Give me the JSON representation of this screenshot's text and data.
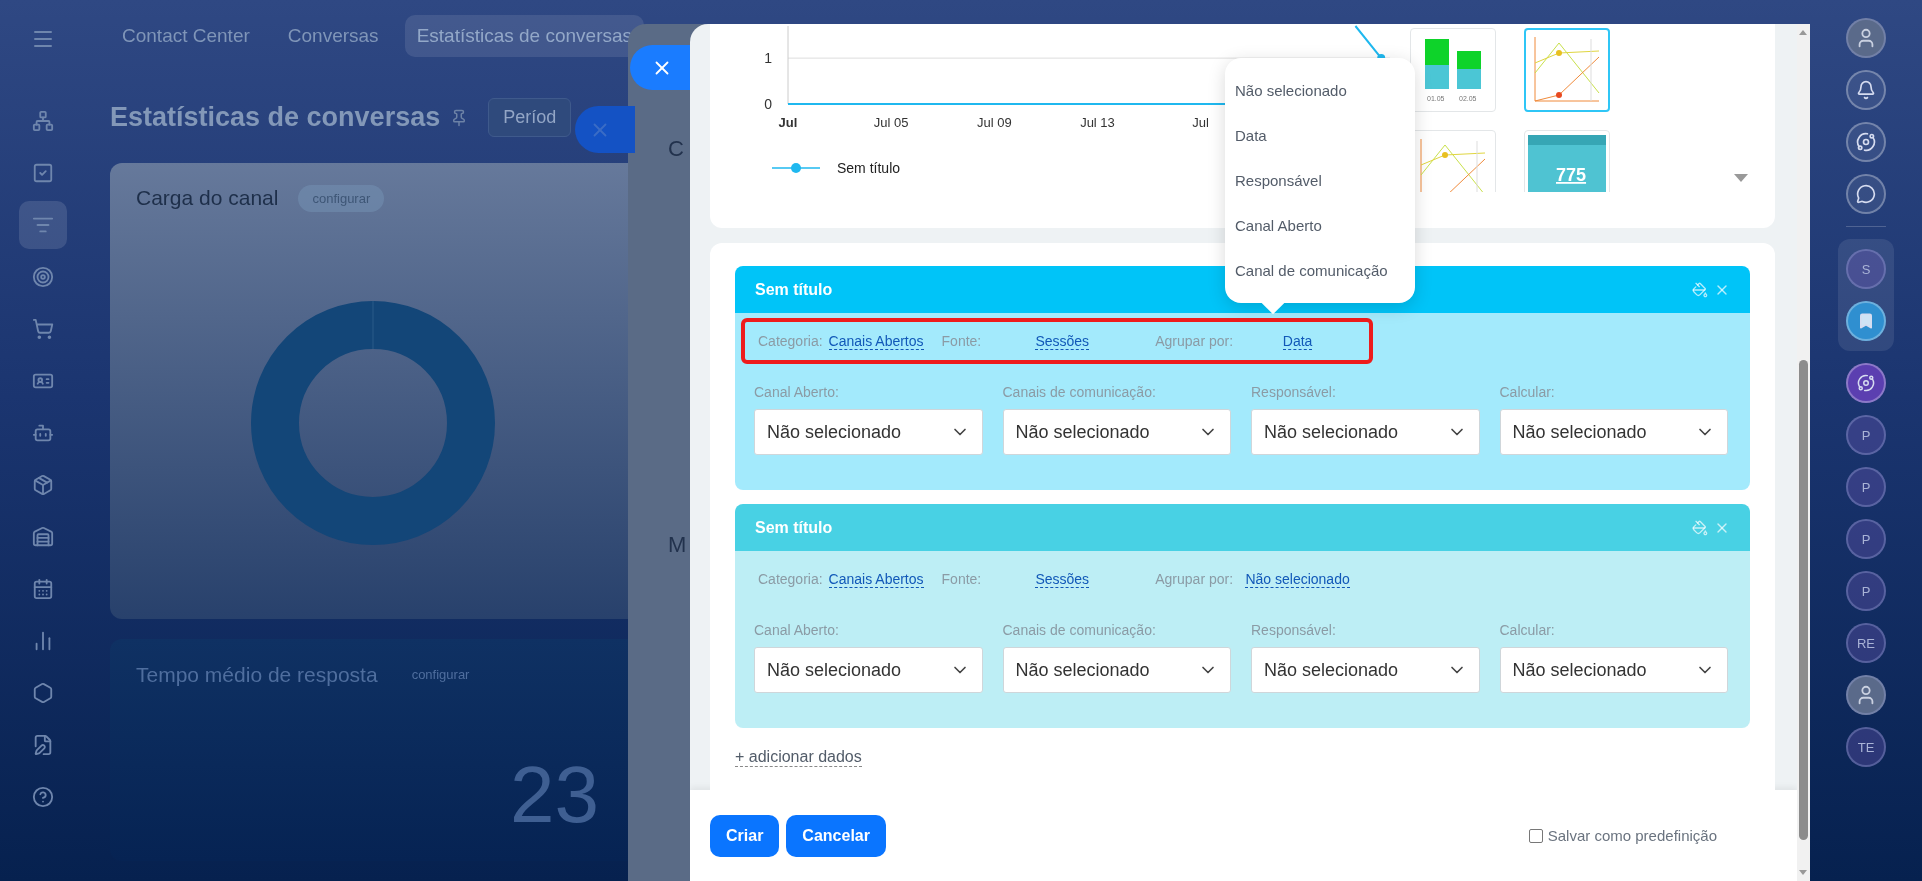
{
  "top_nav": [
    {
      "label": "Contact Center",
      "selected": false
    },
    {
      "label": "Conversas",
      "selected": false
    },
    {
      "label": "Estatísticas de conversas",
      "selected": true
    }
  ],
  "left_nav": [
    {
      "selected": false
    },
    {
      "selected": false
    },
    {
      "selected": true
    },
    {
      "selected": false
    },
    {
      "selected": false
    },
    {
      "selected": false
    },
    {
      "selected": false
    },
    {
      "selected": false
    },
    {
      "selected": false
    },
    {
      "selected": false
    },
    {
      "selected": false
    },
    {
      "selected": false
    },
    {
      "selected": false
    },
    {
      "selected": false
    }
  ],
  "page": {
    "title": "Estatísticas de conversas",
    "period_button": "Períod",
    "widgets": [
      {
        "kind": "donut",
        "title": "Carga do canal",
        "action": "configurar"
      },
      {
        "kind": "number",
        "title": "Tempo médio de resposta",
        "action": "configurar",
        "value": "23"
      }
    ]
  },
  "back_panel": {
    "texts": [
      "C",
      "M"
    ]
  },
  "editor": {
    "chart": {
      "chart_data": {
        "type": "line",
        "categories": [
          "Jul",
          null,
          null,
          null,
          "Jul 05",
          null,
          null,
          null,
          "Jul 09",
          null,
          null,
          null,
          "Jul 13",
          null,
          null,
          null,
          "Jul",
          null,
          null,
          null,
          null,
          null,
          null,
          null
        ],
        "series": [
          {
            "name": "Sem título",
            "color": "#1fb8ef",
            "values": [
              0,
              0,
              0,
              0,
              0,
              0,
              0,
              0,
              0,
              0,
              0,
              0,
              0,
              0,
              0,
              0,
              0,
              0,
              null,
              null,
              null,
              null,
              1.7,
              1
            ]
          }
        ],
        "ylim": [
          0,
          1.7
        ],
        "yticks": [
          0,
          1
        ]
      }
    },
    "chart_types": [
      {
        "kind": "bar",
        "labels": [
          "01.05",
          "02.05"
        ],
        "selected": false
      },
      {
        "kind": "line",
        "selected": true
      },
      {
        "kind": "line",
        "selected": false
      },
      {
        "kind": "number",
        "value": "775",
        "selected": false
      }
    ],
    "group_menu": [
      "Não selecionado",
      "Data",
      "Responsável",
      "Canal Aberto",
      "Canal de comunicação"
    ],
    "datasets": [
      {
        "title": "Sem título",
        "color": "#00c4f8",
        "highlighted": true,
        "fields": [
          {
            "label": "Categoria:",
            "value": "Canais Abertos"
          },
          {
            "label": "Fonte:",
            "value": "Sessões"
          },
          {
            "label": "Agrupar por:",
            "value": "Data"
          }
        ],
        "filters": [
          {
            "label": "Canal Aberto:",
            "value": "Não selecionado"
          },
          {
            "label": "Canais de comunicação:",
            "value": "Não selecionado"
          },
          {
            "label": "Responsável:",
            "value": "Não selecionado"
          },
          {
            "label": "Calcular:",
            "value": "Não selecionado"
          }
        ]
      },
      {
        "title": "Sem título",
        "color": "#48d1e4",
        "highlighted": false,
        "fields": [
          {
            "label": "Categoria:",
            "value": "Canais Abertos"
          },
          {
            "label": "Fonte:",
            "value": "Sessões"
          },
          {
            "label": "Agrupar por:",
            "value": "Não selecionado"
          }
        ],
        "filters": [
          {
            "label": "Canal Aberto:",
            "value": "Não selecionado"
          },
          {
            "label": "Canais de comunicação:",
            "value": "Não selecionado"
          },
          {
            "label": "Responsável:",
            "value": "Não selecionado"
          },
          {
            "label": "Calcular:",
            "value": "Não selecionado"
          }
        ]
      }
    ],
    "add_link": "+ adicionar dados",
    "buttons": [
      {
        "kind": "primary",
        "label": "Criar"
      },
      {
        "kind": "primary",
        "label": "Cancelar"
      }
    ],
    "save_preset": {
      "label": "Salvar como predefinição",
      "checked": false
    }
  },
  "right_rail": [
    {
      "kind": "photo"
    },
    {
      "kind": "bell"
    },
    {
      "kind": "swirl"
    },
    {
      "kind": "chat"
    },
    {
      "kind": "initials",
      "label": "S",
      "pinned": true
    },
    {
      "kind": "bookmark",
      "pinned": true
    },
    {
      "kind": "logo"
    },
    {
      "kind": "initials",
      "label": "P"
    },
    {
      "kind": "initials",
      "label": "P"
    },
    {
      "kind": "initials",
      "label": "P"
    },
    {
      "kind": "initials",
      "label": "P"
    },
    {
      "kind": "initials",
      "label": "RE"
    },
    {
      "kind": "photo"
    },
    {
      "kind": "initials",
      "label": "TE"
    }
  ]
}
